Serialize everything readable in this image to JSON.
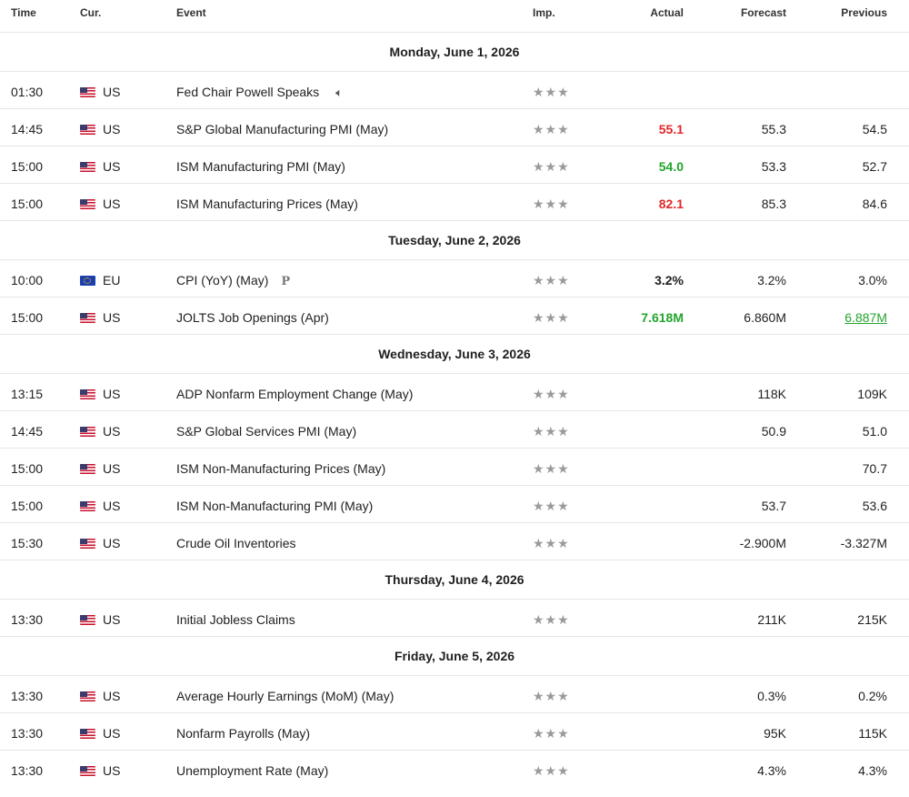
{
  "headers": {
    "time": "Time",
    "cur": "Cur.",
    "event": "Event",
    "imp": "Imp.",
    "actual": "Actual",
    "forecast": "Forecast",
    "previous": "Previous"
  },
  "icons": {
    "us_flag": "us-flag-icon",
    "eu_flag": "eu-flag-icon",
    "star": "star-icon",
    "speaker": "speaker-icon",
    "preliminary": "preliminary-icon"
  },
  "colors": {
    "red": "#e0282a",
    "green": "#24a52d"
  },
  "days": [
    {
      "date": "Monday, June 1, 2026",
      "events": [
        {
          "time": "01:30",
          "cur": "US",
          "event": "Fed Chair Powell Speaks",
          "stars": "★★★",
          "actual": "",
          "forecast": "",
          "previous": ""
        },
        {
          "time": "14:45",
          "cur": "US",
          "event": "S&P Global Manufacturing PMI  (May)",
          "stars": "★★★",
          "actual": "55.1",
          "forecast": "55.3",
          "previous": "54.5"
        },
        {
          "time": "15:00",
          "cur": "US",
          "event": "ISM Manufacturing PMI  (May)",
          "stars": "★★★",
          "actual": "54.0",
          "forecast": "53.3",
          "previous": "52.7"
        },
        {
          "time": "15:00",
          "cur": "US",
          "event": "ISM Manufacturing Prices  (May)",
          "stars": "★★★",
          "actual": "82.1",
          "forecast": "85.3",
          "previous": "84.6"
        }
      ]
    },
    {
      "date": "Tuesday, June 2, 2026",
      "events": [
        {
          "time": "10:00",
          "cur": "EU",
          "event": "CPI (YoY)  (May)",
          "stars": "★★★",
          "actual": "3.2%",
          "forecast": "3.2%",
          "previous": "3.0%"
        },
        {
          "time": "15:00",
          "cur": "US",
          "event": "JOLTS Job Openings  (Apr)",
          "stars": "★★★",
          "actual": "7.618M",
          "forecast": "6.860M",
          "previous": "6.887M"
        }
      ]
    },
    {
      "date": "Wednesday, June 3, 2026",
      "events": [
        {
          "time": "13:15",
          "cur": "US",
          "event": "ADP Nonfarm Employment Change  (May)",
          "stars": "★★★",
          "actual": "",
          "forecast": "118K",
          "previous": "109K"
        },
        {
          "time": "14:45",
          "cur": "US",
          "event": "S&P Global Services PMI  (May)",
          "stars": "★★★",
          "actual": "",
          "forecast": "50.9",
          "previous": "51.0"
        },
        {
          "time": "15:00",
          "cur": "US",
          "event": "ISM Non-Manufacturing Prices  (May)",
          "stars": "★★★",
          "actual": "",
          "forecast": "",
          "previous": "70.7"
        },
        {
          "time": "15:00",
          "cur": "US",
          "event": "ISM Non-Manufacturing PMI  (May)",
          "stars": "★★★",
          "actual": "",
          "forecast": "53.7",
          "previous": "53.6"
        },
        {
          "time": "15:30",
          "cur": "US",
          "event": "Crude Oil Inventories",
          "stars": "★★★",
          "actual": "",
          "forecast": "-2.900M",
          "previous": "-3.327M"
        }
      ]
    },
    {
      "date": "Thursday, June 4, 2026",
      "events": [
        {
          "time": "13:30",
          "cur": "US",
          "event": "Initial Jobless Claims",
          "stars": "★★★",
          "actual": "",
          "forecast": "211K",
          "previous": "215K"
        }
      ]
    },
    {
      "date": "Friday, June 5, 2026",
      "events": [
        {
          "time": "13:30",
          "cur": "US",
          "event": "Average Hourly Earnings (MoM)  (May)",
          "stars": "★★★",
          "actual": "",
          "forecast": "0.3%",
          "previous": "0.2%"
        },
        {
          "time": "13:30",
          "cur": "US",
          "event": "Nonfarm Payrolls  (May)",
          "stars": "★★★",
          "actual": "",
          "forecast": "95K",
          "previous": "115K"
        },
        {
          "time": "13:30",
          "cur": "US",
          "event": "Unemployment Rate  (May)",
          "stars": "★★★",
          "actual": "",
          "forecast": "4.3%",
          "previous": "4.3%"
        }
      ]
    }
  ]
}
